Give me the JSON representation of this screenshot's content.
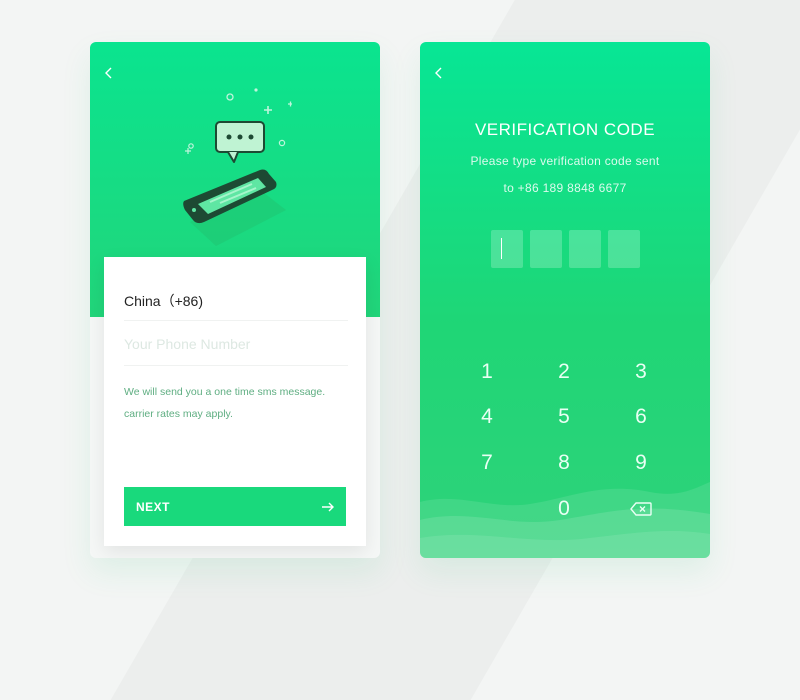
{
  "login": {
    "country": "China（+86)",
    "phone_placeholder": "Your Phone Number",
    "hint_line1": "We will send you a one time sms message.",
    "hint_line2": "carrier rates may apply.",
    "next_label": "NEXT"
  },
  "verify": {
    "title": "VERIFICATION CODE",
    "subtitle_line1": "Please type verification code sent",
    "subtitle_line2": "to +86 189 8848 6677",
    "keys": [
      "1",
      "2",
      "3",
      "4",
      "5",
      "6",
      "7",
      "8",
      "9",
      "0"
    ]
  },
  "icons": {
    "back": "chevron-left-icon",
    "next": "arrow-right-icon",
    "delete": "backspace-icon",
    "illustration": "phone-message-illustration"
  },
  "colors": {
    "primary": "#19d97c",
    "gradient_top": "#07e695",
    "gradient_bottom": "#22d57a"
  }
}
